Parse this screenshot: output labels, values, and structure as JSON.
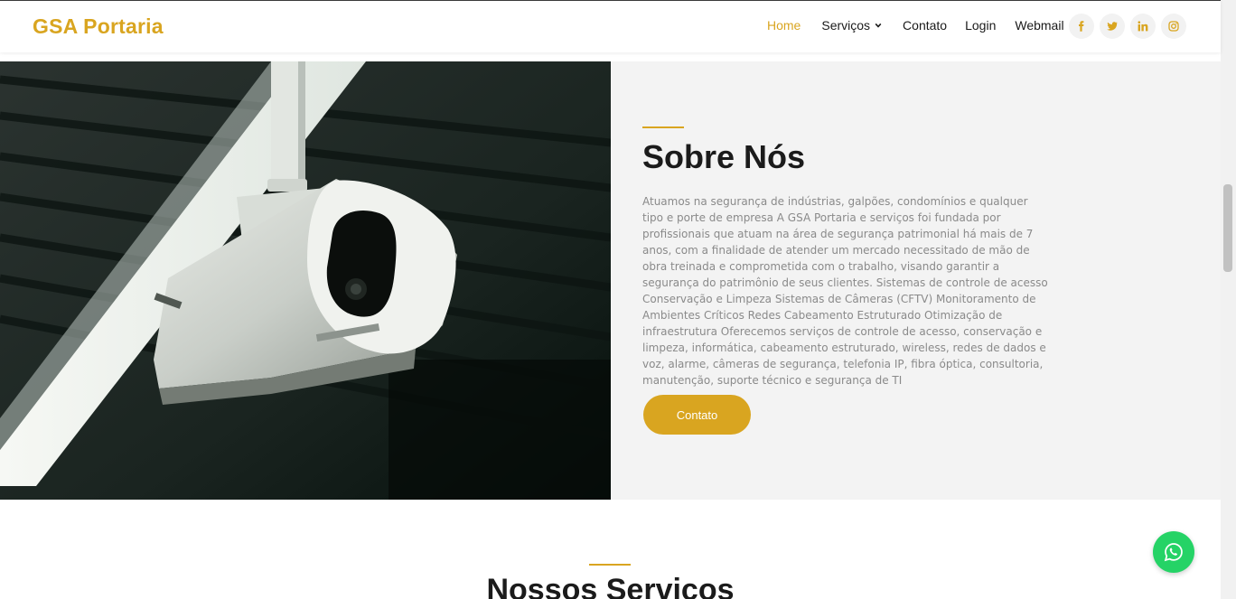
{
  "header": {
    "logo": "GSA Portaria",
    "nav": {
      "home": "Home",
      "servicos": "Serviços",
      "contato": "Contato",
      "login": "Login",
      "webmail": "Webmail"
    },
    "social_icons": [
      "facebook-icon",
      "twitter-icon",
      "linkedin-icon",
      "instagram-icon"
    ]
  },
  "about": {
    "title": "Sobre Nós",
    "text": "Atuamos na segurança de indústrias, galpões, condomínios e qualquer tipo e porte de empresa A GSA Portaria e serviços foi fundada por profissionais que atuam na área de segurança patrimonial há mais de 7 anos, com a finalidade de atender um mercado necessitado de mão de obra treinada e comprometida com o trabalho, visando garantir a segurança do patrimônio de seus clientes. Sistemas de controle de acesso Conservação e Limpeza Sistemas de Câmeras (CFTV) Monitoramento de Ambientes Críticos Redes Cabeamento Estruturado Otimização de infraestrutura Oferecemos serviços de controle de acesso, conservação e limpeza, informática, cabeamento estruturado, wireless, redes de dados e voz, alarme, câmeras de segurança, telefonia IP, fibra óptica, consultoria, manutenção, suporte técnico e segurança de TI",
    "button": "Contato"
  },
  "services": {
    "title": "Nossos Serviços"
  },
  "colors": {
    "accent": "#d9a520",
    "whatsapp": "#25d366",
    "panel_bg": "#f3f3f3"
  }
}
